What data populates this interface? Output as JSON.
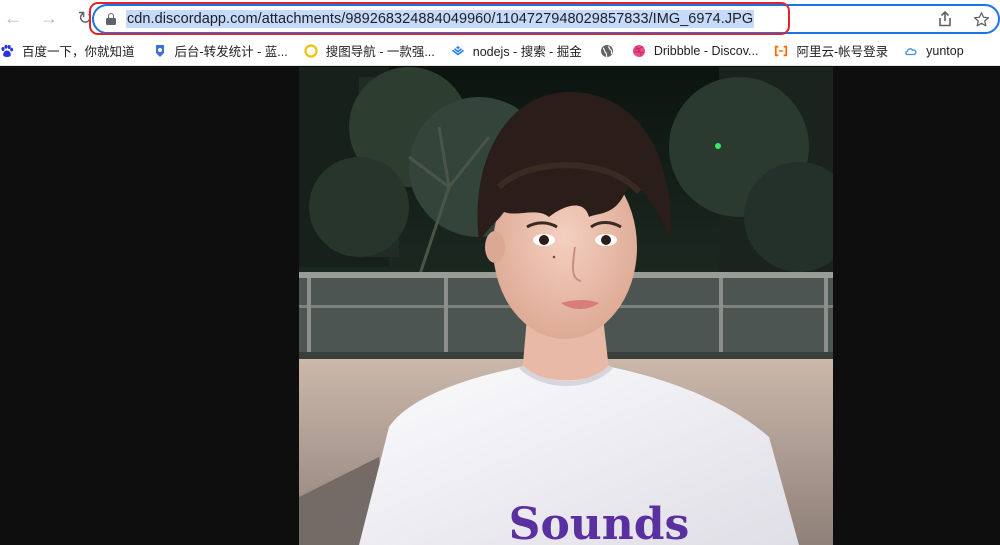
{
  "browser": {
    "url": "cdn.discordapp.com/attachments/989268324884049960/1104727948029857833/IMG_6974.JPG",
    "nav": {
      "back": "←",
      "forward": "→",
      "reload": "↻"
    },
    "icons": {
      "share": "share-icon",
      "star": "star-icon",
      "lock": "lock-icon"
    },
    "accent_color": "#1a73e8",
    "highlight_color": "#e1242b"
  },
  "bookmarks": [
    {
      "label": "百度一下，你就知道",
      "icon": "baidu-paw-icon",
      "color": "#2932e1"
    },
    {
      "label": "后台-转发统计 - 蓝...",
      "icon": "blue-badge-icon",
      "color": "#3b6fe0"
    },
    {
      "label": "搜图导航 - 一款强...",
      "icon": "yellow-ring-icon",
      "color": "#f2c100"
    },
    {
      "label": "nodejs - 搜索 - 掘金",
      "icon": "juejin-icon",
      "color": "#1e80ff"
    },
    {
      "label": "",
      "icon": "globe-icon",
      "color": "#5f6368"
    },
    {
      "label": "Dribbble - Discov...",
      "icon": "dribbble-icon",
      "color": "#ea4c89"
    },
    {
      "label": "阿里云-帐号登录",
      "icon": "aliyun-icon",
      "color": "#ff6a00"
    },
    {
      "label": "yuntop",
      "icon": "cloud-icon",
      "color": "#4a90e2"
    }
  ],
  "image": {
    "shirt_text": "Sounds"
  }
}
